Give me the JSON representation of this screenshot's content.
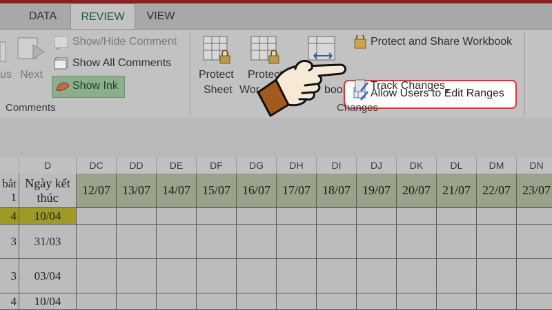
{
  "tabs": [
    "DATA",
    "REVIEW",
    "VIEW"
  ],
  "active_tab": "REVIEW",
  "comments_group": {
    "label": "Comments",
    "prev_label": "us",
    "next_label": "Next",
    "show_hide": "Show/Hide Comment",
    "show_all": "Show All Comments",
    "show_ink": "Show Ink"
  },
  "changes_group": {
    "label": "Changes",
    "protect_sheet_1": "Protect",
    "protect_sheet_2": "Sheet",
    "protect_workbook_1": "Protect",
    "protect_workbook_2": "Wor",
    "share_workbook_2": "book",
    "protect_share": "Protect and Share Workbook",
    "allow_users": "Allow Users to Edit Ranges",
    "track_changes": "Track Changes"
  },
  "columns": [
    "D",
    "DC",
    "DD",
    "DE",
    "DF",
    "DG",
    "DH",
    "DI",
    "DJ",
    "DK",
    "DL",
    "DM",
    "DN"
  ],
  "sheet": {
    "partial_header": "bắt",
    "partial_header_2": "1",
    "end_header": "Ngày kết thúc",
    "dates": [
      "12/07",
      "13/07",
      "14/07",
      "15/07",
      "16/07",
      "17/07",
      "18/07",
      "19/07",
      "20/07",
      "21/07",
      "22/07",
      "23/07"
    ],
    "rows": [
      {
        "start": "4",
        "end": "10/04"
      },
      {
        "start": "3",
        "end": "31/03"
      },
      {
        "start": "3",
        "end": "03/04"
      },
      {
        "start": "4",
        "end": "10/04"
      }
    ]
  },
  "colors": {
    "date_header_bg": "#98a389",
    "yellow_cell": "#9d9a25",
    "highlight_border": "#d23b3b",
    "active_tab_text": "#1e5a31"
  }
}
